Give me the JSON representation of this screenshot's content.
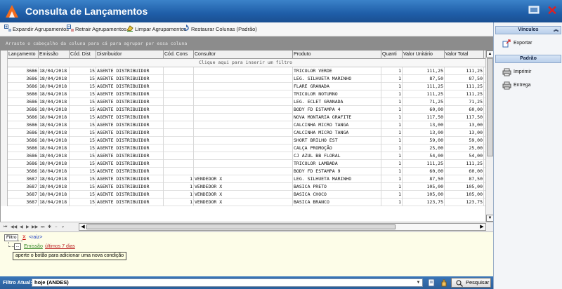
{
  "window": {
    "title": "Consulta de Lançamentos"
  },
  "toolbar": {
    "expand": "Expandir Agrupamentos",
    "collapse": "Retrair Agrupamentos",
    "clear": "Limpar Agrupamentos",
    "restore": "Restaurar Colunas (Padrão)"
  },
  "grid": {
    "group_hint": "Arraste o cabeçalho da coluna para cá para agrupar por essa coluna",
    "filter_row_hint": "Clique aqui para inserir um filtro",
    "columns": [
      "Lançamento",
      "Emissão",
      "Cód. Dist",
      "Distribuidor",
      "Cód. Cons",
      "Consultor",
      "Produto",
      "Quanti",
      "Valor Unitário",
      "Valor Total"
    ],
    "rows": [
      [
        "3686",
        "18/04/2018",
        "15",
        "AGENTE DISTRIBUIDOR",
        "",
        "",
        "TRICOLOR VERDE",
        "1",
        "111,25",
        "111,25"
      ],
      [
        "3686",
        "18/04/2018",
        "15",
        "AGENTE DISTRIBUIDOR",
        "",
        "",
        "LEG. SILHUETA MARINHO",
        "1",
        "87,50",
        "87,50"
      ],
      [
        "3686",
        "18/04/2018",
        "15",
        "AGENTE DISTRIBUIDOR",
        "",
        "",
        "FLARE GRANADA",
        "1",
        "111,25",
        "111,25"
      ],
      [
        "3686",
        "18/04/2018",
        "15",
        "AGENTE DISTRIBUIDOR",
        "",
        "",
        "TRICOLOR NOTURNO",
        "1",
        "111,25",
        "111,25"
      ],
      [
        "3686",
        "18/04/2018",
        "15",
        "AGENTE DISTRIBUIDOR",
        "",
        "",
        "LEG. ECLET GRANADA",
        "1",
        "71,25",
        "71,25"
      ],
      [
        "3686",
        "18/04/2018",
        "15",
        "AGENTE DISTRIBUIDOR",
        "",
        "",
        "BODY FD ESTAMPA 4",
        "1",
        "60,00",
        "60,00"
      ],
      [
        "3686",
        "18/04/2018",
        "15",
        "AGENTE DISTRIBUIDOR",
        "",
        "",
        "NOVA MONTARIA GRAFITE",
        "1",
        "117,50",
        "117,50"
      ],
      [
        "3686",
        "18/04/2018",
        "15",
        "AGENTE DISTRIBUIDOR",
        "",
        "",
        "CALCINHA MICRO TANGA",
        "1",
        "13,00",
        "13,00"
      ],
      [
        "3686",
        "18/04/2018",
        "15",
        "AGENTE DISTRIBUIDOR",
        "",
        "",
        "CALCINHA MICRO TANGA",
        "1",
        "13,00",
        "13,00"
      ],
      [
        "3686",
        "18/04/2018",
        "15",
        "AGENTE DISTRIBUIDOR",
        "",
        "",
        "SHORT BRILHO EST",
        "1",
        "59,00",
        "59,00"
      ],
      [
        "3686",
        "18/04/2018",
        "15",
        "AGENTE DISTRIBUIDOR",
        "",
        "",
        "CALÇA  PROMOÇÃO",
        "1",
        "25,00",
        "25,00"
      ],
      [
        "3686",
        "18/04/2018",
        "15",
        "AGENTE DISTRIBUIDOR",
        "",
        "",
        "CJ AZUL BB FLORAL",
        "1",
        "54,00",
        "54,00"
      ],
      [
        "3686",
        "18/04/2018",
        "15",
        "AGENTE DISTRIBUIDOR",
        "",
        "",
        "TRICOLOR LAMBADA",
        "1",
        "111,25",
        "111,25"
      ],
      [
        "3686",
        "18/04/2018",
        "15",
        "AGENTE DISTRIBUIDOR",
        "",
        "",
        "BODY FD ESTAMPA 9",
        "1",
        "60,00",
        "60,00"
      ],
      [
        "3687",
        "18/04/2018",
        "15",
        "AGENTE DISTRIBUIDOR",
        "1",
        "VENDEDOR X",
        "LEG. SILHUETA MARINHO",
        "1",
        "87,50",
        "87,50"
      ],
      [
        "3687",
        "18/04/2018",
        "15",
        "AGENTE DISTRIBUIDOR",
        "1",
        "VENDEDOR X",
        "BASICA PRETO",
        "1",
        "105,00",
        "105,00"
      ],
      [
        "3687",
        "18/04/2018",
        "15",
        "AGENTE DISTRIBUIDOR",
        "1",
        "VENDEDOR X",
        "BASICA CHOCO",
        "1",
        "105,00",
        "105,00"
      ],
      [
        "3687",
        "18/04/2018",
        "15",
        "AGENTE DISTRIBUIDOR",
        "1",
        "VENDEDOR X",
        "BASICA BRANCO",
        "1",
        "123,75",
        "123,75"
      ]
    ]
  },
  "filter": {
    "tab": "Filtro",
    "remove": "X",
    "root": "<raiz>",
    "add_button": "...",
    "field": "Emissão",
    "value": "últimos 7 dias",
    "tooltip": "aperte o botão para adicionar uma nova condição"
  },
  "status": {
    "label": "Filtro Atual:",
    "value": "hoje (ANDES)",
    "search_button": "Pesquisar"
  },
  "side": {
    "section1": "Vínculos",
    "export": "Exportar",
    "section2": "Padrão",
    "print": "Imprimir",
    "delivery": "Entrega"
  },
  "colors": {
    "titlebar": "#1f5ea8",
    "group_panel": "#8c8c8c",
    "filter_panel": "#fdfde8",
    "close": "#e02020"
  }
}
